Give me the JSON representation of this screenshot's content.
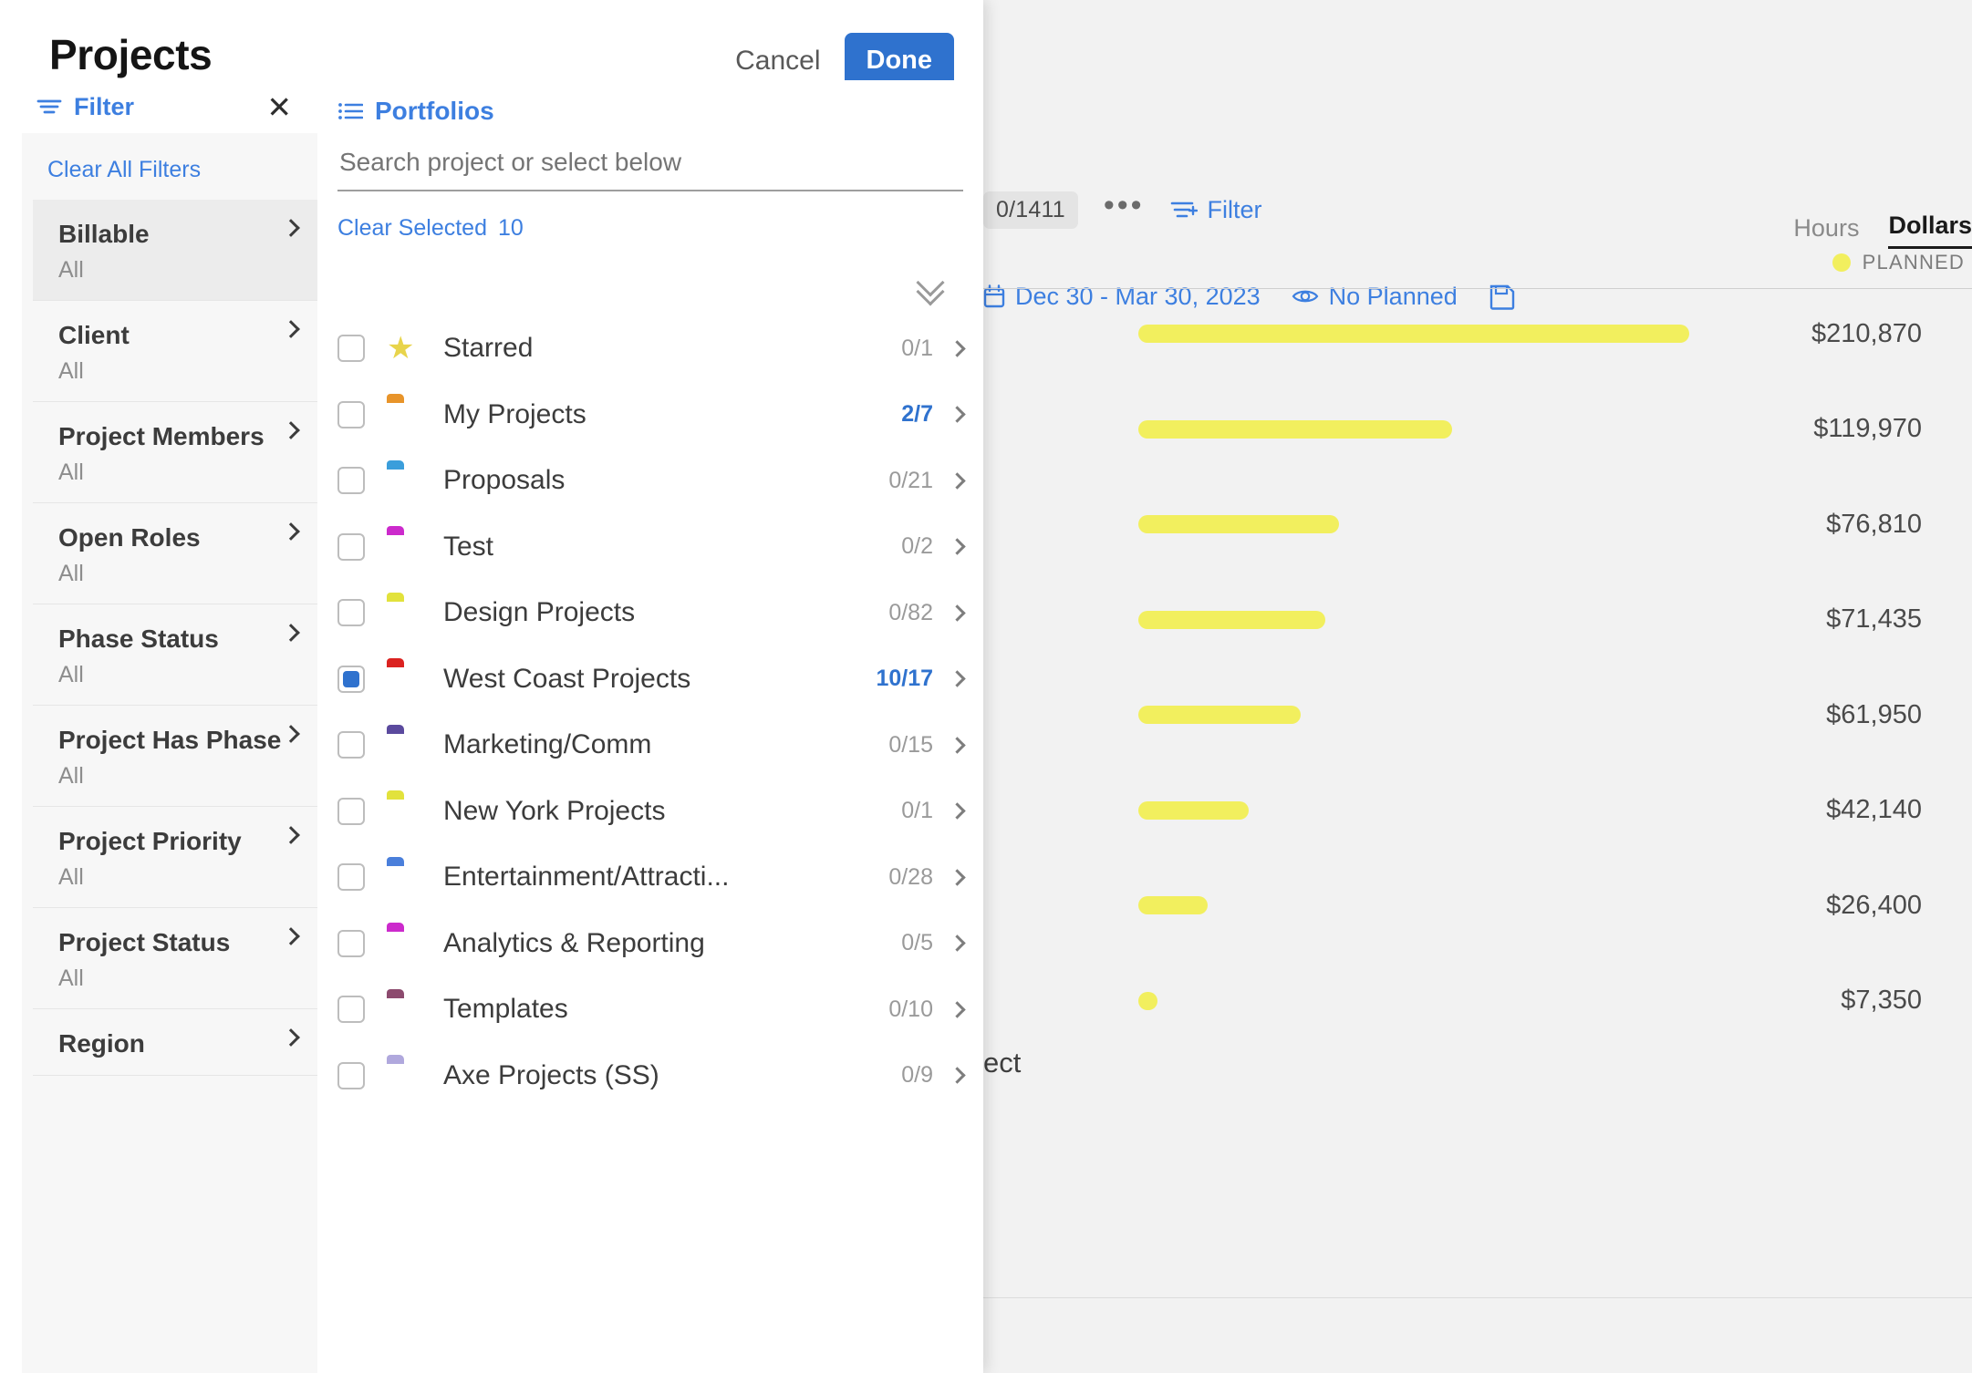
{
  "modal": {
    "title": "Projects",
    "cancel_label": "Cancel",
    "done_label": "Done"
  },
  "filter_panel": {
    "header_label": "Filter",
    "close_icon": "close-icon",
    "clear_all_label": "Clear All Filters",
    "items": [
      {
        "title": "Billable",
        "value": "All",
        "selected": true
      },
      {
        "title": "Client",
        "value": "All",
        "selected": false
      },
      {
        "title": "Project Members",
        "value": "All",
        "selected": false
      },
      {
        "title": "Open Roles",
        "value": "All",
        "selected": false
      },
      {
        "title": "Phase Status",
        "value": "All",
        "selected": false
      },
      {
        "title": "Project Has Phase",
        "value": "All",
        "selected": false
      },
      {
        "title": "Project Priority",
        "value": "All",
        "selected": false
      },
      {
        "title": "Project Status",
        "value": "All",
        "selected": false
      },
      {
        "title": "Region",
        "value": "",
        "selected": false
      }
    ]
  },
  "portfolio_panel": {
    "header_label": "Portfolios",
    "header_icon": "list-icon",
    "search": {
      "placeholder": "Search project or select below",
      "value": ""
    },
    "clear_selected_label": "Clear Selected",
    "clear_selected_count": "10",
    "collapse_icon": "double-chevron-down-icon",
    "rows": [
      {
        "label": "Starred",
        "count": "0/1",
        "icon": "star-icon",
        "color": "#e8d44b",
        "checked": false,
        "highlight": false
      },
      {
        "label": "My Projects",
        "count": "2/7",
        "icon": "folder-icon",
        "color": "#e8942a",
        "checked": false,
        "highlight": true
      },
      {
        "label": "Proposals",
        "count": "0/21",
        "icon": "folder-icon",
        "color": "#3b9edb",
        "checked": false,
        "highlight": false
      },
      {
        "label": "Test",
        "count": "0/2",
        "icon": "folder-icon",
        "color": "#cc2acc",
        "checked": false,
        "highlight": false
      },
      {
        "label": "Design Projects",
        "count": "0/82",
        "icon": "folder-icon",
        "color": "#e2e23c",
        "checked": false,
        "highlight": false
      },
      {
        "label": "West Coast Projects",
        "count": "10/17",
        "icon": "folder-icon",
        "color": "#db2220",
        "checked": true,
        "highlight": true
      },
      {
        "label": "Marketing/Comm",
        "count": "0/15",
        "icon": "folder-icon",
        "color": "#5b4a9e",
        "checked": false,
        "highlight": false
      },
      {
        "label": "New York Projects",
        "count": "0/1",
        "icon": "folder-icon",
        "color": "#e2e23c",
        "checked": false,
        "highlight": false
      },
      {
        "label": "Entertainment/Attracti...",
        "count": "0/28",
        "icon": "folder-icon",
        "color": "#4a7fdb",
        "checked": false,
        "highlight": false
      },
      {
        "label": "Analytics & Reporting",
        "count": "0/5",
        "icon": "folder-icon",
        "color": "#cc2acc",
        "checked": false,
        "highlight": false
      },
      {
        "label": "Templates",
        "count": "0/10",
        "icon": "folder-icon",
        "color": "#8c4a6e",
        "checked": false,
        "highlight": false
      },
      {
        "label": "Axe Projects (SS)",
        "count": "0/9",
        "icon": "folder-icon",
        "color": "#b0a8dd",
        "checked": false,
        "highlight": false
      }
    ]
  },
  "background": {
    "project_count_badge": "0/1411",
    "more_icon": "ellipsis-icon",
    "filter_label": "Filter",
    "filter_icon": "filter-add-icon",
    "date_range": "Dec 30 - Mar 30, 2023",
    "date_icon": "calendar-icon",
    "planned_toggle": "No Planned",
    "planned_toggle_icon": "eye-icon",
    "save_icon": "save-icon",
    "unit_tabs": [
      {
        "label": "Hours",
        "active": false
      },
      {
        "label": "Dollars",
        "active": true
      }
    ],
    "legend": {
      "label": "PLANNED",
      "color": "#f2ef5e"
    },
    "truncated_row_label": "ect"
  },
  "chart_data": {
    "type": "bar",
    "title": "",
    "orientation": "horizontal",
    "categories": [
      "",
      "",
      "",
      "",
      "",
      "",
      "",
      ""
    ],
    "values": [
      210870,
      119970,
      76810,
      71435,
      61950,
      42140,
      26400,
      7350
    ],
    "value_labels": [
      "$210,870",
      "$119,970",
      "$76,810",
      "$71,435",
      "$61,950",
      "$42,140",
      "$26,400",
      "$7,350"
    ],
    "series": [
      {
        "name": "PLANNED",
        "color": "#f2ef5e",
        "values": [
          210870,
          119970,
          76810,
          71435,
          61950,
          42140,
          26400,
          7350
        ]
      }
    ],
    "xlabel": "",
    "ylabel": "",
    "xlim": [
      0,
      230000
    ],
    "grid": false,
    "legend_position": "top-right",
    "unit": "dollars"
  }
}
